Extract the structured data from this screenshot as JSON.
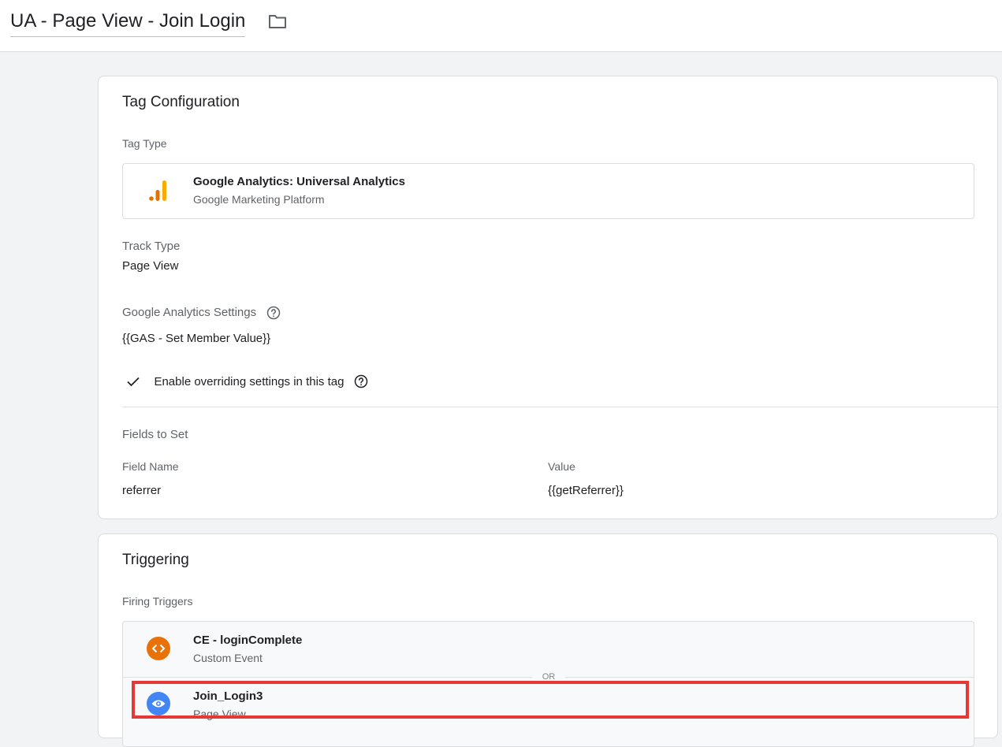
{
  "header": {
    "title": "UA - Page View - Join Login",
    "folder_icon": "folder-icon"
  },
  "tag_config": {
    "title": "Tag Configuration",
    "tag_type_label": "Tag Type",
    "tag_type": {
      "name": "Google Analytics: Universal Analytics",
      "provider": "Google Marketing Platform",
      "icon": "google-analytics-icon",
      "icon_colors": [
        "#e37400",
        "#f9ab00"
      ]
    },
    "track_type_label": "Track Type",
    "track_type_value": "Page View",
    "ga_settings_label": "Google Analytics Settings",
    "ga_settings_value": "{{GAS - Set Member Value}}",
    "override_label": "Enable overriding settings in this tag",
    "override_checked": true,
    "fields_to_set_label": "Fields to Set",
    "field_name_header": "Field Name",
    "value_header": "Value",
    "fields": [
      {
        "name": "referrer",
        "value": "{{getReferrer}}"
      }
    ]
  },
  "triggering": {
    "title": "Triggering",
    "firing_label": "Firing Triggers",
    "or_label": "OR",
    "triggers": [
      {
        "name": "CE - loginComplete",
        "type": "Custom Event",
        "icon": "code-brackets-icon",
        "color": "#e8710a"
      },
      {
        "name": "Join_Login3",
        "type": "Page View",
        "icon": "eye-icon",
        "color": "#4285f4",
        "highlighted": true
      }
    ],
    "highlight_color": "#e53935"
  }
}
